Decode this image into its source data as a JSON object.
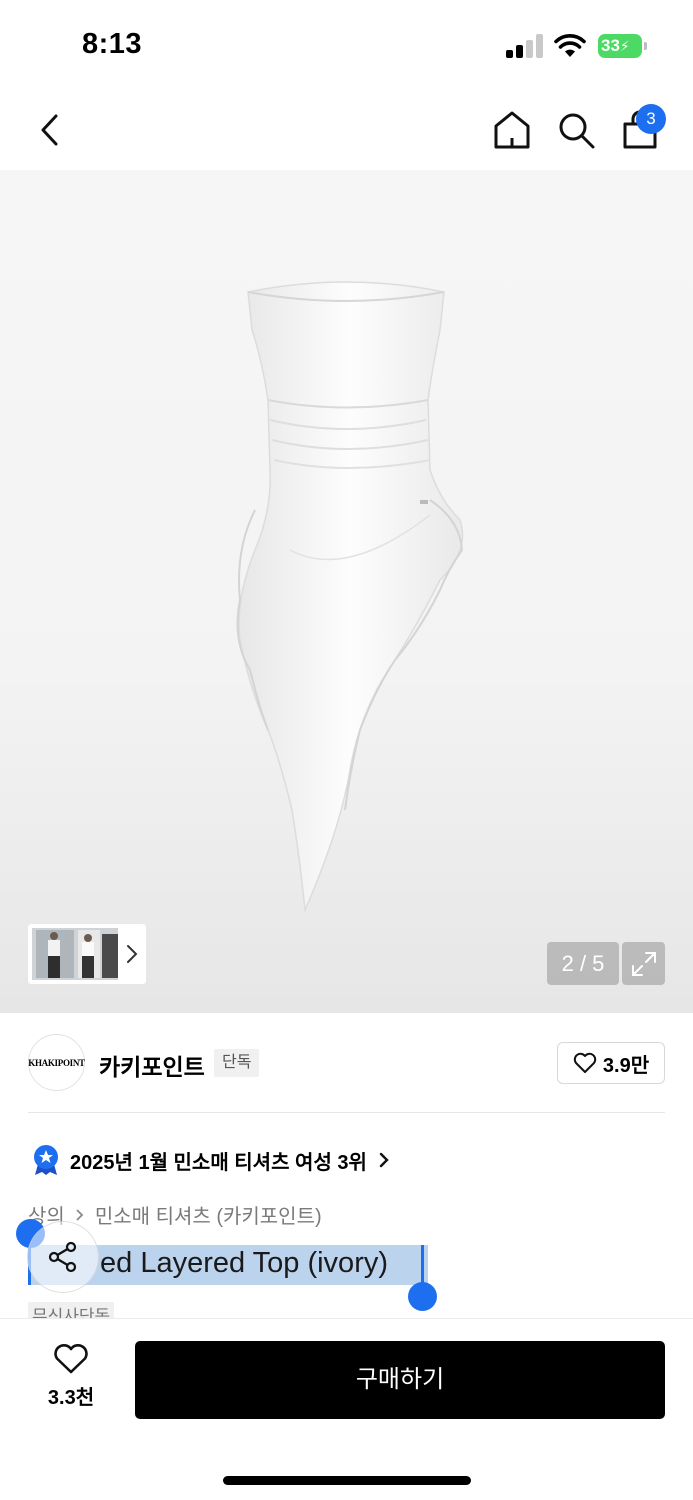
{
  "status_bar": {
    "time": "8:13",
    "battery": "33"
  },
  "nav": {
    "cart_count": "3",
    "icons": [
      "back-icon",
      "home-icon",
      "search-icon",
      "bag-icon"
    ]
  },
  "gallery": {
    "counter": "2 / 5",
    "current_index": 2,
    "total": 5
  },
  "brand": {
    "logo_text": "KHAKIPOINT",
    "name": "카키포인트",
    "tag": "단독",
    "likes": "3.9만"
  },
  "ranking": {
    "text": "2025년 1월 민소매 티셔츠 여성 3위"
  },
  "breadcrumb": {
    "category": "상의",
    "subcategory": "민소매 티셔츠 (카키포인트)"
  },
  "product": {
    "title": "ed Layered Top (ivory)",
    "tag": "무신사단독"
  },
  "bottom_bar": {
    "wish_count": "3.3천",
    "buy_label": "구매하기"
  },
  "colors": {
    "accent": "#1e6ff0",
    "selection": "#bcd3ee",
    "buy_button": "#000000"
  }
}
